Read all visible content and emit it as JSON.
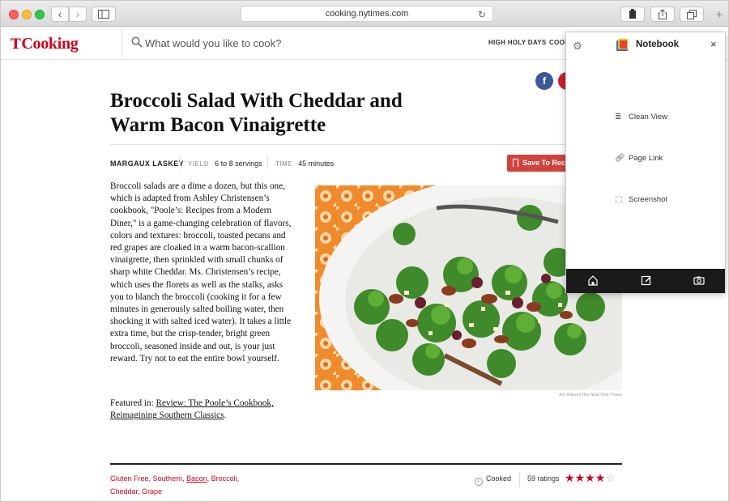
{
  "browser": {
    "url": "cooking.nytimes.com"
  },
  "header": {
    "logo_mark": "T",
    "logo_text": "Cooking",
    "search_placeholder": "What would you like to cook?",
    "nav": [
      "HIGH HOLY DAYS",
      "COOK"
    ]
  },
  "recipe": {
    "title": "Broccoli Salad With Cheddar and Warm Bacon Vinaigrette",
    "author": "MARGAUX LASKEY",
    "yield_label": "YIELD",
    "yield_value": "6 to 8 servings",
    "time_label": "TIME",
    "time_value": "45 minutes",
    "save_label": "Save To Recipe Box",
    "intro": "Broccoli salads are a dime a dozen, but this one, which is adapted from Ashley Christensen’s cookbook, \"Poole’s: Recipes from a Modern Diner,\" is a game-changing celebration of flavors, colors and textures: broccoli, toasted pecans and red grapes are cloaked in a warm bacon-scallion vinaigrette, then sprinkled with small chunks of sharp white Cheddar. Ms. Christensen’s recipe, which uses the florets as well as the stalks, asks you to blanch the broccoli (cooking it for a few minutes in generously salted boiling water, then shocking it with salted iced water). It takes a little extra time, but the crisp-tender, bright green broccoli, seasoned inside and out, is your just reward. Try not to eat the entire bowl yourself.",
    "featured_prefix": "Featured in: ",
    "featured_link": "Review: The Poole’s Cookbook, Reimagining Southern Classics",
    "featured_suffix": ".",
    "photo_credit": "Jim Wilson/The New York Times",
    "tags": [
      "Gluten Free",
      "Southern",
      "Bacon",
      "Broccoli",
      "Cheddar",
      "Grape"
    ],
    "cooked_label": "Cooked",
    "ratings_text": "59 ratings",
    "rating": 4,
    "rating_max": 5,
    "share": {
      "facebook": "f"
    }
  },
  "notebook": {
    "title": "Notebook",
    "close": "×",
    "items": [
      "Clean View",
      "Page Link",
      "Screenshot"
    ]
  },
  "colors": {
    "brand_red": "#d0021b",
    "save_button": "#d0443d",
    "facebook": "#3b5998",
    "pinterest": "#cb2027",
    "notebook_bar": "#1a1a1a"
  },
  "icons": {
    "toolbar": [
      "chevron-left-icon",
      "chevron-right-icon",
      "sidebar-icon",
      "reload-icon",
      "evernote-icon",
      "share-icon",
      "tabs-icon",
      "new-tab-icon"
    ],
    "notebook_bar": [
      "home-icon",
      "edit-icon",
      "camera-icon"
    ]
  }
}
